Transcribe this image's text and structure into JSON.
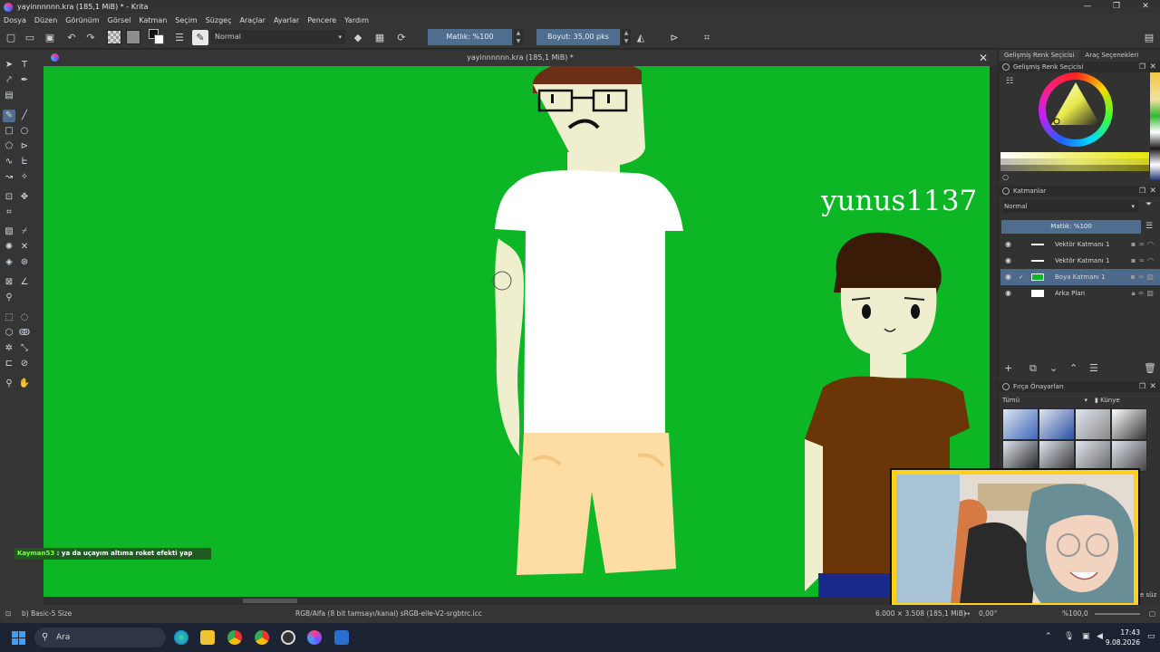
{
  "window": {
    "title": "yayinnnnnn.kra (185,1 MiB) * - Krita",
    "controls": [
      "—",
      "❐",
      "✕"
    ]
  },
  "menu": [
    "Dosya",
    "Düzen",
    "Görünüm",
    "Görsel",
    "Katman",
    "Seçim",
    "Süzgeç",
    "Araçlar",
    "Ayarlar",
    "Pencere",
    "Yardım"
  ],
  "toolbar": {
    "blend_mode": "Normal",
    "opacity_label": "Matlık: %100",
    "size_label": "Boyut: 35,00 pks"
  },
  "document": {
    "tab_title": "yayinnnnnn.kra (185,1 MiB) *",
    "close": "✕"
  },
  "canvas_text": {
    "watermark": "yunus1137"
  },
  "chat": {
    "user": "Kayman53",
    "message": " : ya da uçayım altıma roket efekti yap"
  },
  "docker": {
    "tabs": [
      "Gelişmiş Renk Seçicisi",
      "Araç Seçenekleri"
    ],
    "color_panel_title": "Gelişmiş Renk Seçicisi",
    "layers_panel_title": "Katmanlar",
    "layers_blend": "Normal",
    "layers_opacity": "Matlık: %100",
    "layers": [
      {
        "name": "Vektör Katmanı 1",
        "selected": false,
        "checked": false
      },
      {
        "name": "Vektör Katmanı 1",
        "selected": false,
        "checked": false
      },
      {
        "name": "Boya Katmanı 1",
        "selected": true,
        "checked": true
      },
      {
        "name": "Arka Plan",
        "selected": false,
        "checked": false
      }
    ],
    "brush_panel_title": "Fırça Önayarları",
    "brush_filter": "Tümü",
    "brush_tag": "Künye",
    "brush_search_suffix": "e süz"
  },
  "statusbar": {
    "brush_name": "b) Basic-5 Size",
    "color_profile": "RGB/Alfa (8 bit tamsayı/kanal) sRGB-elle-V2-srgbtrc.icc",
    "dimensions": "6.000 × 3.508 (185,1 MiB)",
    "rotation": "0,00°",
    "zoom": "%100,0"
  },
  "taskbar": {
    "search_placeholder": "Ara",
    "time": "17:43",
    "date": "9.08.2026"
  },
  "colors": {
    "canvas_green": "#0db624",
    "accent": "#4f6d8f"
  }
}
